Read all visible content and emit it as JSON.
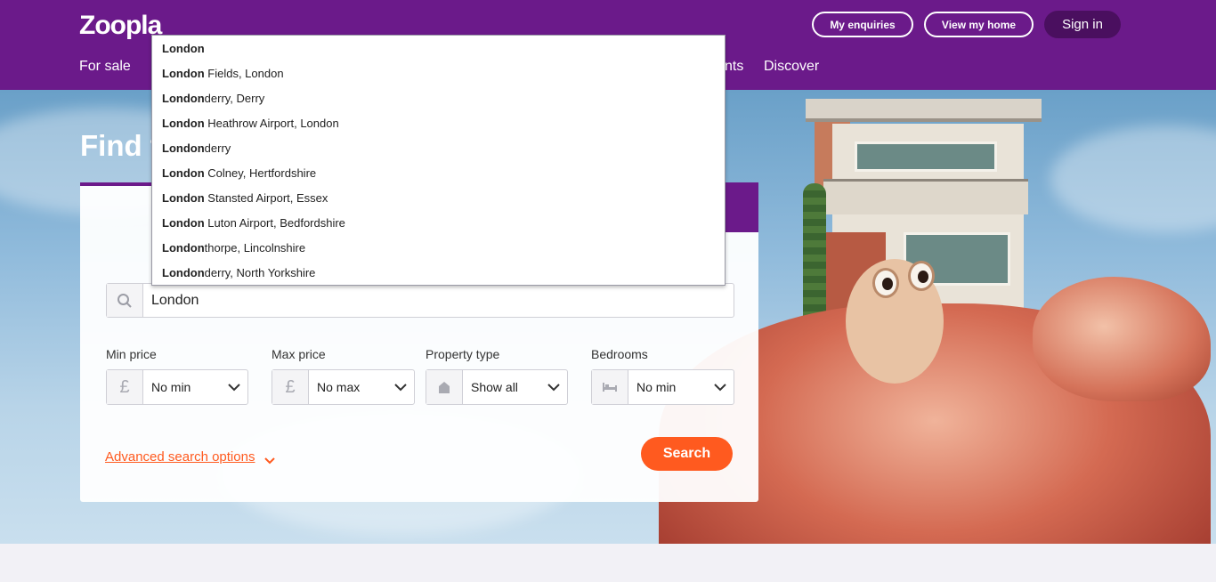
{
  "header": {
    "logo": "Zoopla",
    "my_enquiries": "My enquiries",
    "view_my_home": "View my home",
    "sign_in": "Sign in",
    "nav": {
      "for_sale": "For sale",
      "partial": "nts",
      "discover": "Discover"
    }
  },
  "hero": {
    "title_partial": "Find t"
  },
  "search": {
    "query": "London",
    "autocomplete": [
      {
        "bold": "London",
        "rest": ""
      },
      {
        "bold": "London",
        "rest": " Fields, London"
      },
      {
        "bold": "London",
        "rest": "derry, Derry"
      },
      {
        "bold": "London",
        "rest": " Heathrow Airport, London"
      },
      {
        "bold": "London",
        "rest": "derry"
      },
      {
        "bold": "London",
        "rest": " Colney, Hertfordshire"
      },
      {
        "bold": "London",
        "rest": " Stansted Airport, Essex"
      },
      {
        "bold": "London",
        "rest": " Luton Airport, Bedfordshire"
      },
      {
        "bold": "London",
        "rest": "thorpe, Lincolnshire"
      },
      {
        "bold": "London",
        "rest": "derry, North Yorkshire"
      }
    ],
    "filters": {
      "min_price_label": "Min price",
      "min_price_value": "No min",
      "max_price_label": "Max price",
      "max_price_value": "No max",
      "property_type_label": "Property type",
      "property_type_value": "Show all",
      "bedrooms_label": "Bedrooms",
      "bedrooms_value": "No min",
      "currency_symbol": "£"
    },
    "advanced_link": "Advanced search options",
    "search_button": "Search"
  },
  "colors": {
    "brand_purple": "#6b1a8a",
    "accent_orange": "#ff5a1f"
  }
}
